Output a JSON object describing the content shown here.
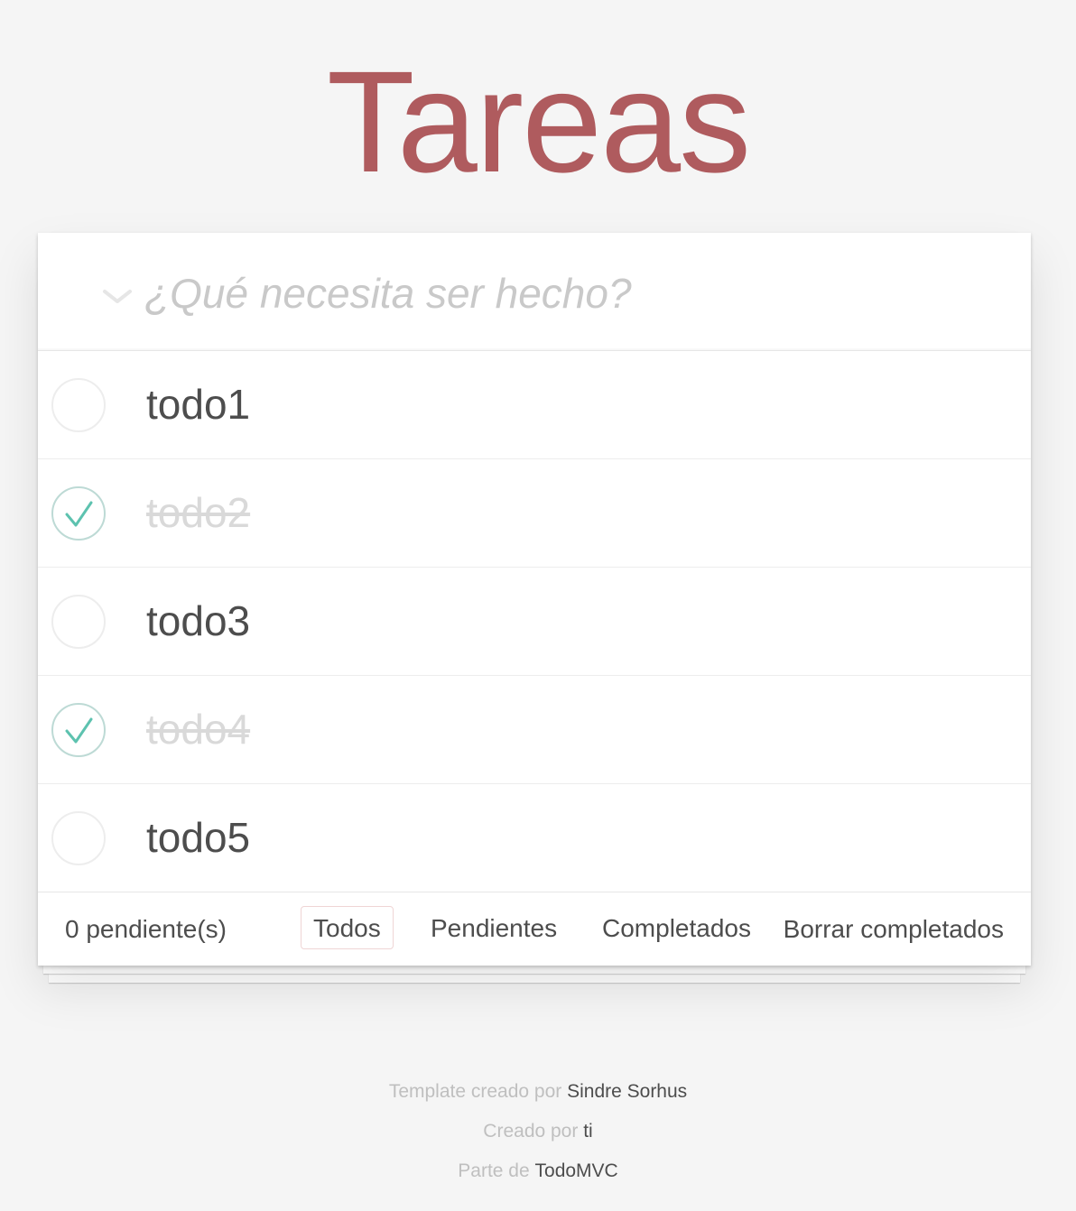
{
  "app": {
    "title": "Tareas",
    "title_color": "#af5b5e"
  },
  "new_todo": {
    "placeholder": "¿Qué necesita ser hecho?",
    "value": ""
  },
  "todos": [
    {
      "label": "todo1",
      "completed": false
    },
    {
      "label": "todo2",
      "completed": true
    },
    {
      "label": "todo3",
      "completed": false
    },
    {
      "label": "todo4",
      "completed": true
    },
    {
      "label": "todo5",
      "completed": false
    }
  ],
  "footer": {
    "count": "0 pendiente(s)",
    "filters": {
      "all": "Todos",
      "active": "Pendientes",
      "completed": "Completados"
    },
    "selected_filter": "all",
    "clear_completed": "Borrar completados"
  },
  "info": {
    "line1_prefix": "Template creado por ",
    "line1_link": "Sindre Sorhus",
    "line2_prefix": "Creado por ",
    "line2_link": "ti",
    "line3_prefix": "Parte de ",
    "line3_link": "TodoMVC"
  },
  "colors": {
    "check_green": "#5dc2af",
    "circle_border": "#ededed",
    "completed_text": "#d9d9d9"
  },
  "icons": {
    "toggle_all": "chevron-down-icon",
    "unchecked": "circle-icon",
    "checked": "checkmark-circle-icon"
  }
}
